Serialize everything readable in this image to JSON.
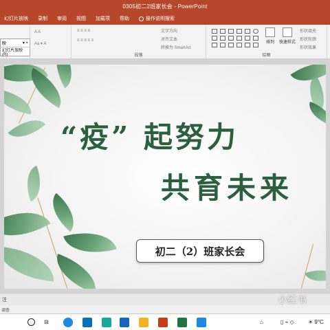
{
  "window": {
    "title": "0305初二2班家长会 - PowerPoint"
  },
  "tabs": [
    {
      "label": "幻灯片放映"
    },
    {
      "label": "录制"
    },
    {
      "label": "审阅"
    },
    {
      "label": "视图"
    },
    {
      "label": "加载项"
    },
    {
      "label": "帮助"
    },
    {
      "label": "操作说明搜索"
    }
  ],
  "ribbon": {
    "text_direction": "文字方向",
    "align_text": "对齐文本",
    "smartart": "转换为 SmartArt",
    "paragraph_group": "段落",
    "drawing_group": "绘图",
    "arrange": "排列",
    "quick_styles": "快速样式",
    "shape_fill": "形状填充",
    "shape_outline": "形状轮廓",
    "shape_effects": "形状效果"
  },
  "popup": {
    "row1": "映",
    "row2": "幻灯片放映(R)"
  },
  "slide": {
    "headline_line1": "“疫” 起努力",
    "headline_line2": "共育未来",
    "subtitle": "初二（2）班家长会"
  },
  "notes_label": "注",
  "status_text": "调查",
  "watermark": "小红书",
  "taskbar": {
    "weather": "9°C",
    "colors": {
      "edge": "#1e88e5",
      "green": "#2e7d32",
      "ppt": "#c43e1c",
      "excel": "#217346"
    }
  },
  "colors": {
    "accent": "#b7472a",
    "headline": "#2c5f3d"
  }
}
